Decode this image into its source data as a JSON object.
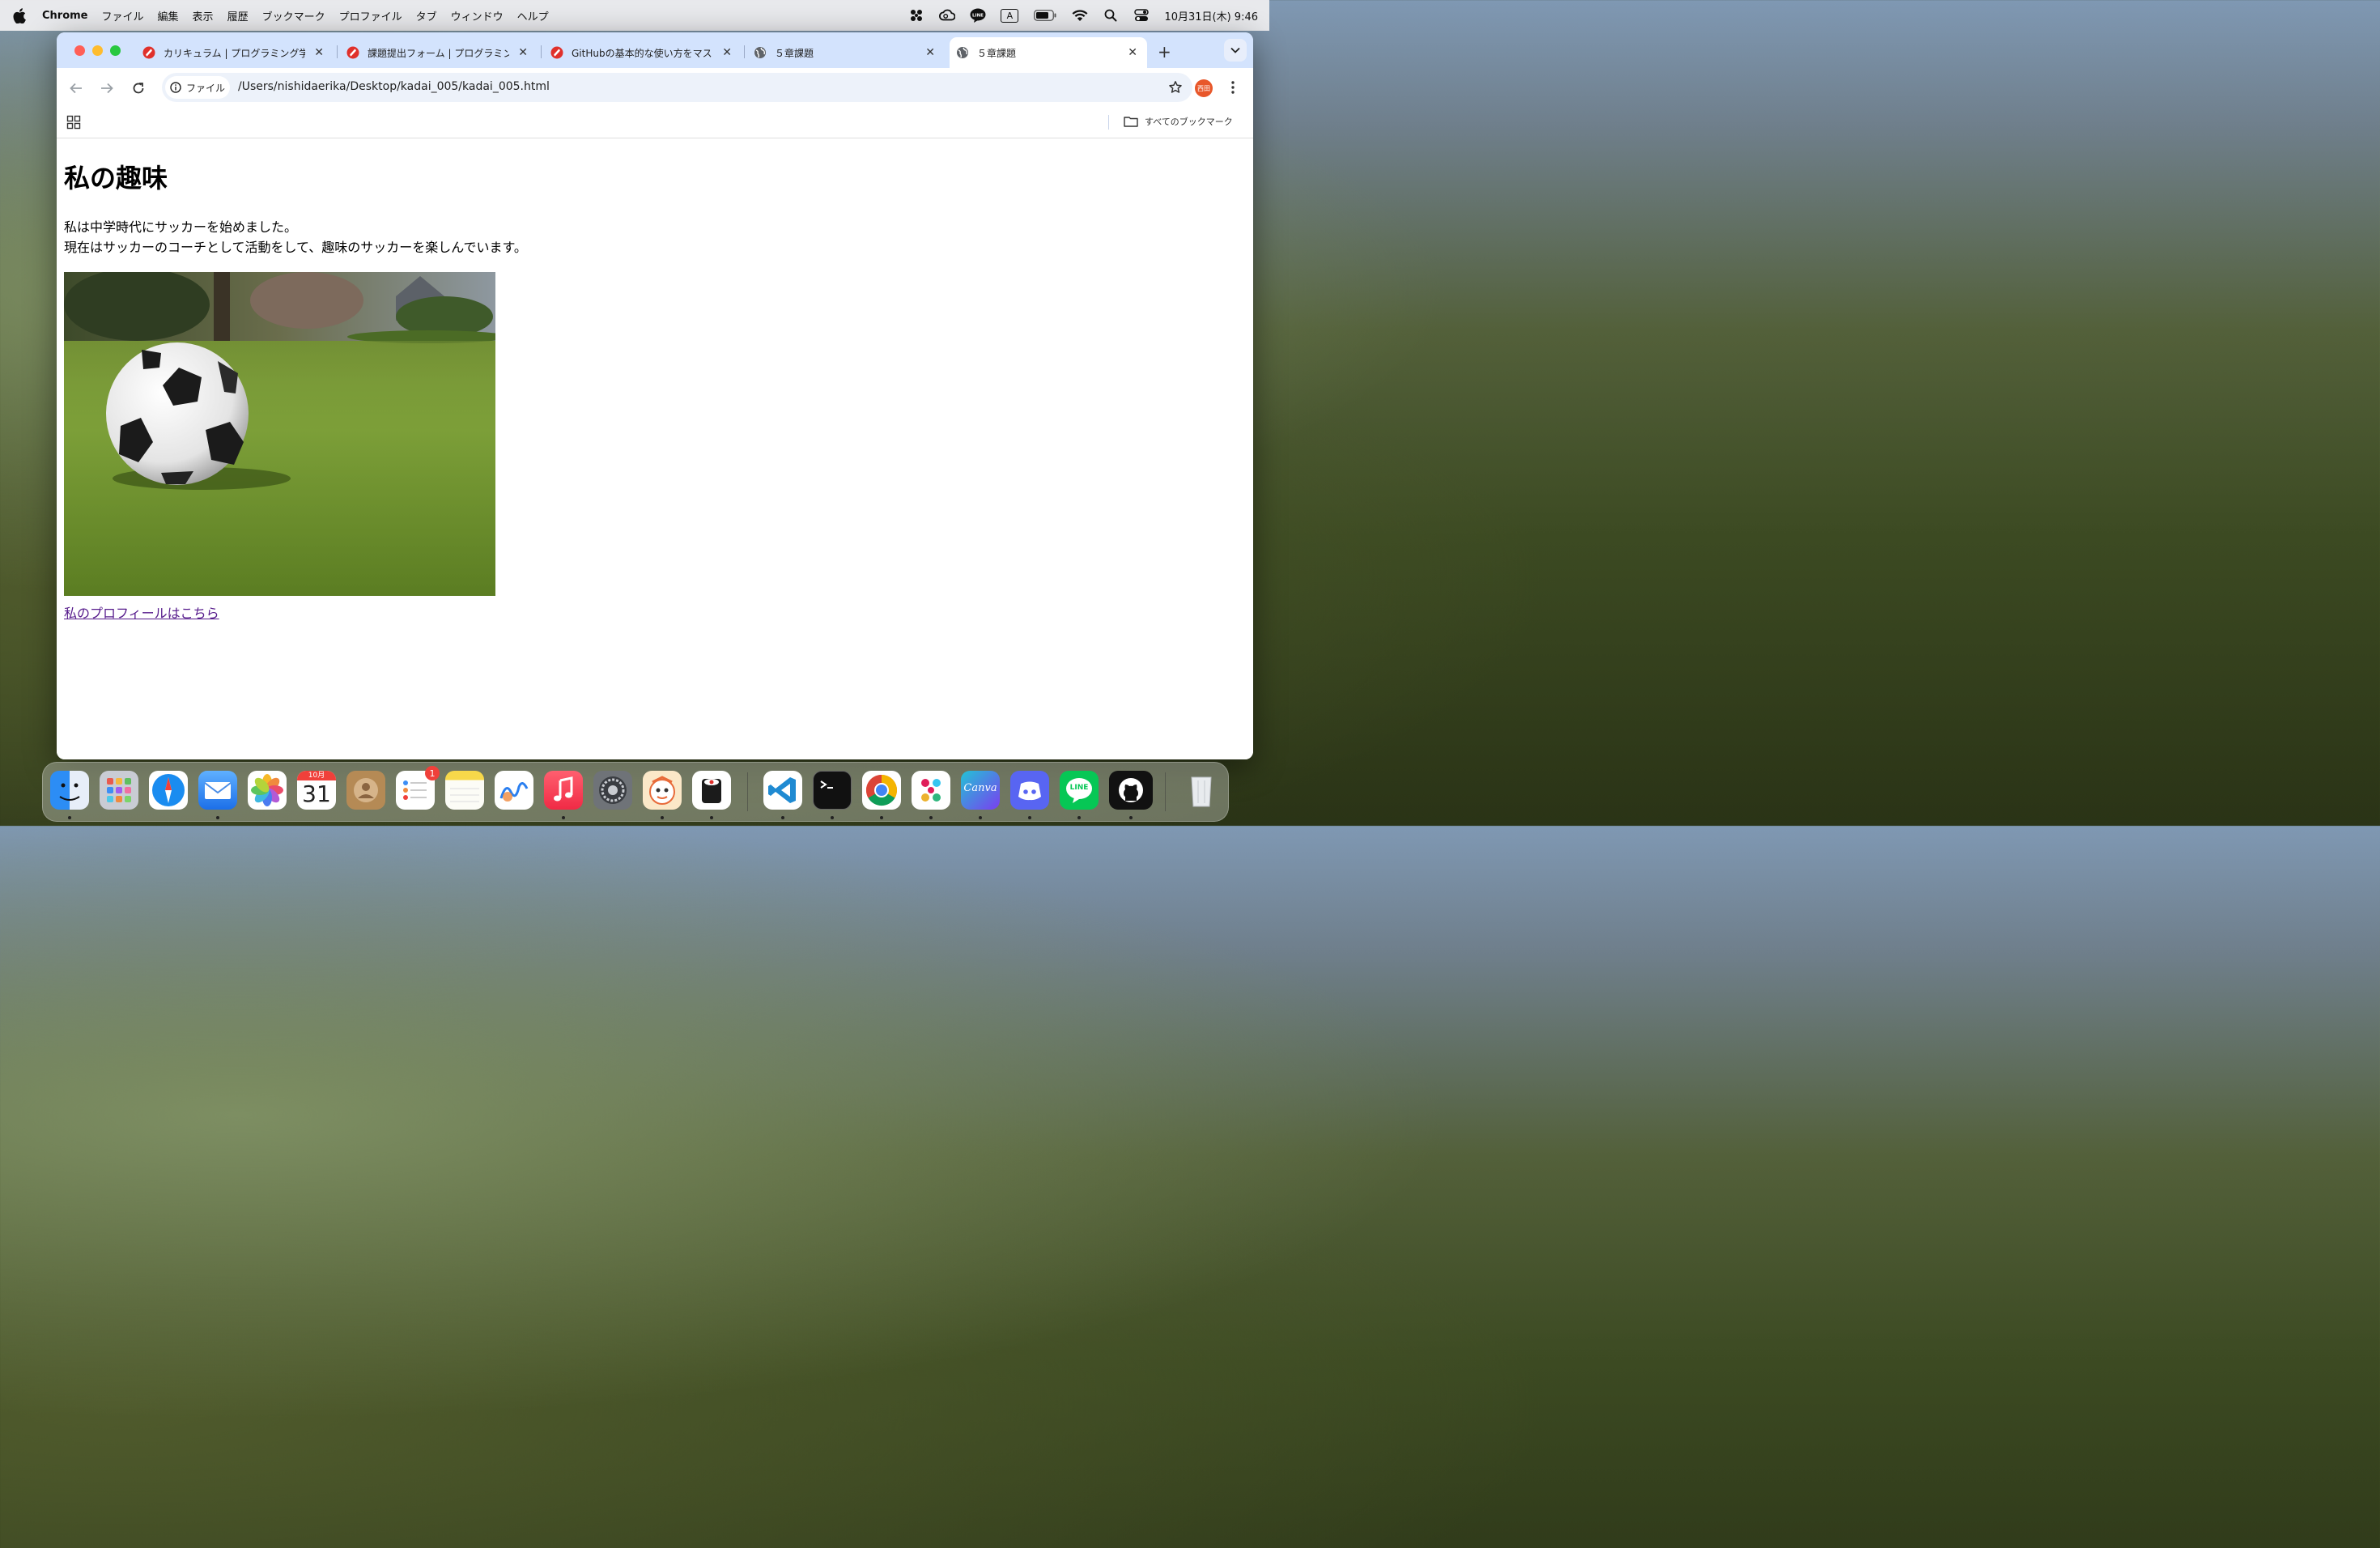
{
  "menubar": {
    "app_name": "Chrome",
    "items": [
      "ファイル",
      "編集",
      "表示",
      "履歴",
      "ブックマーク",
      "プロファイル",
      "タブ",
      "ウィンドウ",
      "ヘルプ"
    ],
    "status_icons": [
      "app-switch-icon",
      "creative-cloud-icon",
      "line-icon",
      "input-source-icon",
      "battery-icon",
      "wifi-icon",
      "spotlight-icon",
      "control-center-icon"
    ],
    "input_source": "A",
    "line_badge": "LINE",
    "clock": "10月31日(木) 9:46"
  },
  "tabs": [
    {
      "title": "カリキュラム | プログラミング学",
      "icon": "samurai-icon"
    },
    {
      "title": "課題提出フォーム | プログラミン",
      "icon": "samurai-icon"
    },
    {
      "title": "GitHubの基本的な使い方をマス",
      "icon": "samurai-icon"
    },
    {
      "title": "５章課題",
      "icon": "globe-icon"
    },
    {
      "title": "５章課題",
      "icon": "globe-icon",
      "active": true
    }
  ],
  "toolbar": {
    "scheme_chip": "ファイル",
    "url": "/Users/nishidaerika/Desktop/kadai_005/kadai_005.html",
    "profile_initials": "西田"
  },
  "bookmarks": {
    "all_bookmarks": "すべてのブックマーク"
  },
  "page": {
    "heading": "私の趣味",
    "paragraph_line1": "私は中学時代にサッカーを始めました。",
    "paragraph_line2": "現在はサッカーのコーチとして活動をして、趣味のサッカーを楽しんでいます。",
    "image_subject": "soccer ball on grass",
    "link_text": "私のプロフィールはこちら"
  },
  "dock": {
    "apps": [
      "finder",
      "launchpad",
      "safari",
      "mail",
      "photos",
      "calendar",
      "contacts",
      "reminders",
      "notes",
      "freeform",
      "music",
      "system-settings",
      "app-character",
      "app-sushi",
      "vscode",
      "terminal",
      "chrome",
      "slack",
      "canva",
      "discord",
      "line",
      "github",
      "trash"
    ],
    "calendar_month": "10月",
    "calendar_day": "31",
    "reminders_badge": "1",
    "canva_label": "Canva",
    "line_label": "LINE"
  },
  "colors": {
    "tabstrip": "#d3e3fd",
    "link_visited": "#551a8b",
    "avatar": "#e8572a",
    "samurai_red": "#e0302b"
  }
}
